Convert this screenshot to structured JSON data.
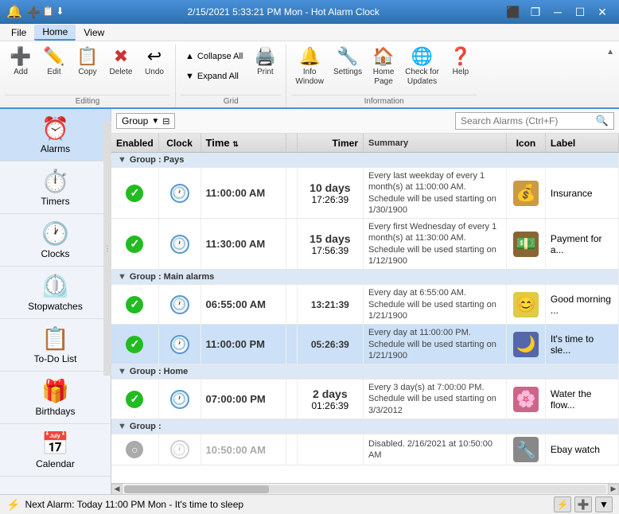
{
  "titlebar": {
    "title": "2/15/2021 5:33:21 PM Mon - Hot Alarm Clock",
    "controls": [
      "minimize",
      "restore",
      "close"
    ]
  },
  "menubar": {
    "items": [
      "File",
      "Home",
      "View"
    ],
    "active": "Home"
  },
  "ribbon": {
    "groups": [
      {
        "name": "Editing",
        "buttons": [
          {
            "id": "add",
            "icon": "➕",
            "label": "Add"
          },
          {
            "id": "edit",
            "icon": "✏️",
            "label": "Edit"
          },
          {
            "id": "copy",
            "icon": "📋",
            "label": "Copy"
          },
          {
            "id": "delete",
            "icon": "✖",
            "label": "Delete"
          },
          {
            "id": "undo",
            "icon": "↩",
            "label": "Undo"
          }
        ]
      },
      {
        "name": "Grid",
        "stacked": [
          {
            "id": "collapse-all",
            "icon": "▲",
            "label": "Collapse All"
          },
          {
            "id": "expand-all",
            "icon": "▼",
            "label": "Expand All"
          }
        ],
        "buttons": [
          {
            "id": "print",
            "icon": "🖨️",
            "label": "Print"
          }
        ]
      },
      {
        "name": "Information",
        "buttons": [
          {
            "id": "info-window",
            "icon": "🔔",
            "label": "Info\nWindow"
          },
          {
            "id": "settings",
            "icon": "🔧",
            "label": "Settings"
          },
          {
            "id": "home-page",
            "icon": "🏠",
            "label": "Home\nPage"
          },
          {
            "id": "check-updates",
            "icon": "🌐",
            "label": "Check for\nUpdates"
          },
          {
            "id": "help",
            "icon": "❓",
            "label": "Help"
          }
        ]
      }
    ]
  },
  "toolbar": {
    "group_label": "Group",
    "search_placeholder": "Search Alarms (Ctrl+F)"
  },
  "table": {
    "headers": [
      "Enabled",
      "Clock",
      "Time",
      "",
      "Timer",
      "Summary",
      "Icon",
      "Label"
    ],
    "groups": [
      {
        "name": "Group : Pays",
        "rows": [
          {
            "enabled": true,
            "clock": true,
            "time": "11:00:00 AM",
            "timer": "10 days\n17:26:39",
            "summary": "Every last weekday of every 1 month(s) at 11:00:00 AM. Schedule will be used starting on 1/30/1900",
            "icon": "💰",
            "icon_bg": "#cc9944",
            "label": "Insurance",
            "selected": false
          },
          {
            "enabled": true,
            "clock": true,
            "time": "11:30:00 AM",
            "timer": "15 days\n17:56:39",
            "summary": "Every first Wednesday of every 1 month(s) at 11:30:00 AM. Schedule will be used starting on 1/12/1900",
            "icon": "💵",
            "icon_bg": "#886633",
            "label": "Payment for a...",
            "selected": false
          }
        ]
      },
      {
        "name": "Group : Main alarms",
        "rows": [
          {
            "enabled": true,
            "clock": true,
            "time": "06:55:00 AM",
            "timer": "13:21:39",
            "summary": "Every day at 6:55:00 AM. Schedule will be used starting on 1/21/1900",
            "icon": "😊",
            "icon_bg": "#ddcc44",
            "label": "Good morning ...",
            "selected": false
          },
          {
            "enabled": true,
            "clock": true,
            "time": "11:00:00 PM",
            "timer": "05:26:39",
            "summary": "Every day at 11:00:00 PM. Schedule will be used starting on 1/21/1900",
            "icon": "🌙",
            "icon_bg": "#5566aa",
            "label": "It's time to sle...",
            "selected": true
          }
        ]
      },
      {
        "name": "Group : Home",
        "rows": [
          {
            "enabled": true,
            "clock": true,
            "time": "07:00:00 PM",
            "timer": "2 days\n01:26:39",
            "summary": "Every 3 day(s) at 7:00:00 PM. Schedule will be used starting on 3/3/2012",
            "icon": "🌸",
            "icon_bg": "#cc6688",
            "label": "Water the flow...",
            "selected": false
          }
        ]
      },
      {
        "name": "Group :",
        "rows": [
          {
            "enabled": false,
            "clock": false,
            "time": "10:50:00 AM",
            "timer": "",
            "summary": "Disabled. 2/16/2021 at 10:50:00 AM",
            "icon": "🔧",
            "icon_bg": "#888888",
            "label": "Ebay watch",
            "selected": false
          }
        ]
      }
    ]
  },
  "sidebar": {
    "items": [
      {
        "id": "alarms",
        "icon": "⏰",
        "label": "Alarms",
        "active": true
      },
      {
        "id": "timers",
        "icon": "⏱️",
        "label": "Timers",
        "active": false
      },
      {
        "id": "clocks",
        "icon": "🕐",
        "label": "Clocks",
        "active": false
      },
      {
        "id": "stopwatches",
        "icon": "⏲️",
        "label": "Stopwatches",
        "active": false
      },
      {
        "id": "todo",
        "icon": "📋",
        "label": "To-Do List",
        "active": false
      },
      {
        "id": "birthdays",
        "icon": "🎁",
        "label": "Birthdays",
        "active": false
      },
      {
        "id": "calendar",
        "icon": "📅",
        "label": "Calendar",
        "active": false
      }
    ]
  },
  "statusbar": {
    "text": "Next Alarm: Today 11:00 PM Mon - It's time to sleep",
    "icon": "⚡"
  }
}
